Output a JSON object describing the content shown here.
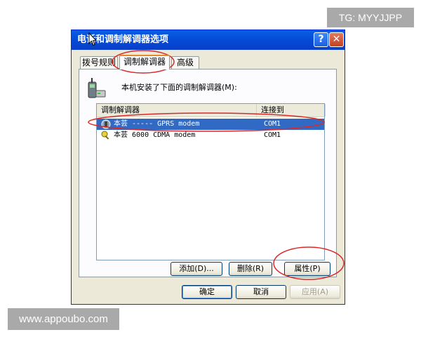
{
  "watermarks": {
    "top": "TG: MYYJJPP",
    "bottom": "www.appoubo.com"
  },
  "window": {
    "title": "电话和调制解调器选项",
    "help_label": "?",
    "close_label": "✕",
    "tabs": [
      {
        "label": "拨号规则",
        "active": false
      },
      {
        "label": "调制解调器",
        "active": true
      },
      {
        "label": "高级",
        "active": false
      }
    ],
    "description": "本机安装了下面的调制解调器(M):",
    "columns": {
      "name": "调制解调器",
      "port": "连接到"
    },
    "rows": [
      {
        "name": "本芸 ----- GPRS modem",
        "port": "COM1",
        "selected": true,
        "icon": "modem-phone-icon"
      },
      {
        "name": "本芸 6000 CDMA modem",
        "port": "COM1",
        "selected": false,
        "icon": "modem-key-icon"
      }
    ],
    "buttons": {
      "add": "添加(D)...",
      "remove": "删除(R)",
      "properties": "属性(P)",
      "ok": "确定",
      "cancel": "取消",
      "apply": "应用(A)"
    }
  },
  "colors": {
    "titlebar": "#0449d6",
    "selection": "#316ac5",
    "annotation": "#d92a2a",
    "dialog_bg": "#ece9d8"
  }
}
